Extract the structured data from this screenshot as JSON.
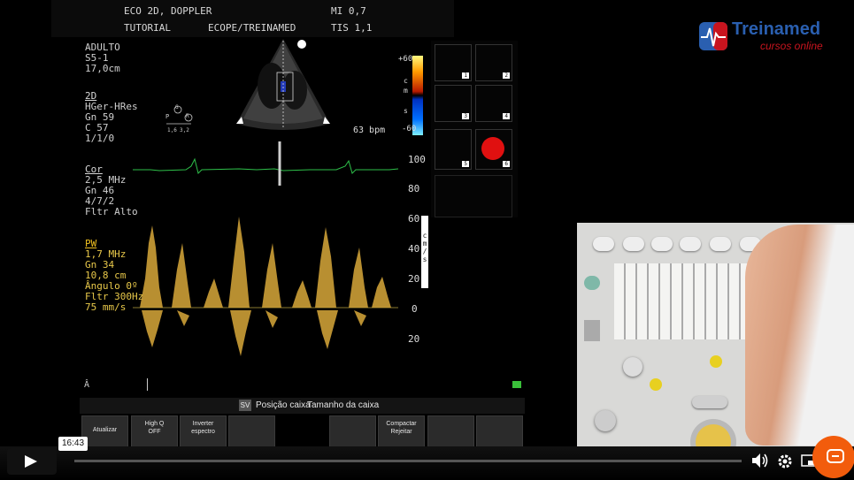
{
  "header": {
    "mode": "ECO 2D, DOPPLER",
    "mi": "MI 0,7",
    "tutorial": "TUTORIAL",
    "source": "ECOPE/TREINAMED",
    "tis": "TIS 1,1"
  },
  "left_panel": {
    "general": [
      "ADULTO",
      "S5-1",
      "17,0cm"
    ],
    "sec_2d": {
      "title": "2D",
      "lines": [
        "HGer-HRes",
        "Gn 59",
        "C 57",
        "1/1/0"
      ]
    },
    "sec_cor": {
      "title": "Cor",
      "lines": [
        "2,5 MHz",
        "Gn 46",
        "4/7/2",
        "Fltr Alto"
      ]
    },
    "sec_pw": {
      "title": "PW",
      "lines": [
        "1,7 MHz",
        "Gn 34",
        "10,8 cm",
        "Ângulo 0º",
        "Fltr 300Hz",
        "75 mm/s"
      ]
    }
  },
  "color_scale": {
    "top": "+60",
    "bottom": "-60",
    "unit_c": "c",
    "unit_m": "m",
    "unit_s": "s"
  },
  "heart_rate": "63 bpm",
  "spectral_scale": {
    "ticks": [
      "100",
      "80",
      "60",
      "40",
      "20",
      "0",
      "20"
    ],
    "unit": "c m / s"
  },
  "probe_indicator": {
    "p": "P",
    "r": "R",
    "g": "G",
    "v1": "1,6",
    "v2": "3,2"
  },
  "status_bar": {
    "sv_badge": "SV",
    "position": "Posição caixa",
    "size": "Tamanho da caixa"
  },
  "softkeys": [
    {
      "label1": "Atualizar",
      "label2": ""
    },
    {
      "label1": "High Q",
      "label2": "OFF"
    },
    {
      "label1": "Inverter",
      "label2": "espectro"
    },
    {
      "label1": "",
      "label2": ""
    },
    {
      "label1": "",
      "label2": ""
    },
    {
      "label1": "Compactar",
      "label2": "Rejeitar"
    },
    {
      "label1": "",
      "label2": ""
    },
    {
      "label1": "",
      "label2": ""
    }
  ],
  "thumbnails": [
    "1",
    "2",
    "3",
    "4",
    "5",
    "6"
  ],
  "logo": {
    "name": "Treinamed",
    "subtitle": "cursos online"
  },
  "player": {
    "time_tooltip": "16:43",
    "progress_fraction": 0.0
  },
  "colors": {
    "logo_blue": "#2a5fb0",
    "logo_red": "#c8141e",
    "doppler_gold": "#e0b040",
    "ecg_green": "#2ec04a",
    "chat_orange": "#f25c0c"
  },
  "icons": [
    "play-icon",
    "volume-icon",
    "settings-icon",
    "pip-icon",
    "chat-icon"
  ]
}
